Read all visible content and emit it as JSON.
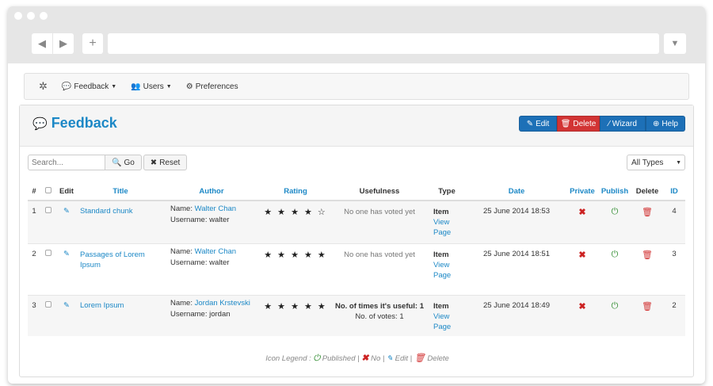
{
  "nav": {
    "items": [
      {
        "label": "Feedback",
        "icon": "comment-icon"
      },
      {
        "label": "Users",
        "icon": "users-icon"
      },
      {
        "label": "Preferences",
        "icon": "gears-icon"
      }
    ]
  },
  "header": {
    "title": "Feedback",
    "buttons": {
      "edit": "Edit",
      "delete": "Delete",
      "wizard": "Wizard",
      "help": "Help"
    }
  },
  "filters": {
    "search_placeholder": "Search...",
    "go_label": "Go",
    "reset_label": "Reset",
    "type_select": "All Types"
  },
  "table": {
    "columns": [
      "#",
      "",
      "Edit",
      "Title",
      "Author",
      "Rating",
      "Usefulness",
      "Type",
      "Date",
      "Private",
      "Publish",
      "Delete",
      "ID"
    ],
    "rows": [
      {
        "num": "1",
        "title": "Standard chunk",
        "name_label": "Name:",
        "author": "Walter Chan",
        "username": "Username: walter",
        "rating": "★ ★ ★ ★ ☆",
        "useful1": "No one has voted yet",
        "useful2": "",
        "type": "Item",
        "view": "View",
        "page": "Page",
        "date": "25 June 2014 18:53",
        "id": "4"
      },
      {
        "num": "2",
        "title": "Passages of Lorem Ipsum",
        "name_label": "Name:",
        "author": "Walter Chan",
        "username": "Username: walter",
        "rating": "★ ★ ★ ★ ★",
        "useful1": "No one has voted yet",
        "useful2": "",
        "type": "Item",
        "view": "View",
        "page": "Page",
        "date": "25 June 2014 18:51",
        "id": "3"
      },
      {
        "num": "3",
        "title": "Lorem Ipsum",
        "name_label": "Name:",
        "author": "Jordan Krstevski",
        "username": "Username: jordan",
        "rating": "★ ★ ★ ★ ★",
        "useful1": "No. of times it's useful: 1",
        "useful2": "No. of votes: 1",
        "type": "Item",
        "view": "View",
        "page": "Page",
        "date": "25 June 2014 18:49",
        "id": "2"
      }
    ]
  },
  "legend": {
    "label": "Icon Legend :",
    "published": "Published",
    "no": "No",
    "edit": "Edit",
    "delete": "Delete"
  }
}
